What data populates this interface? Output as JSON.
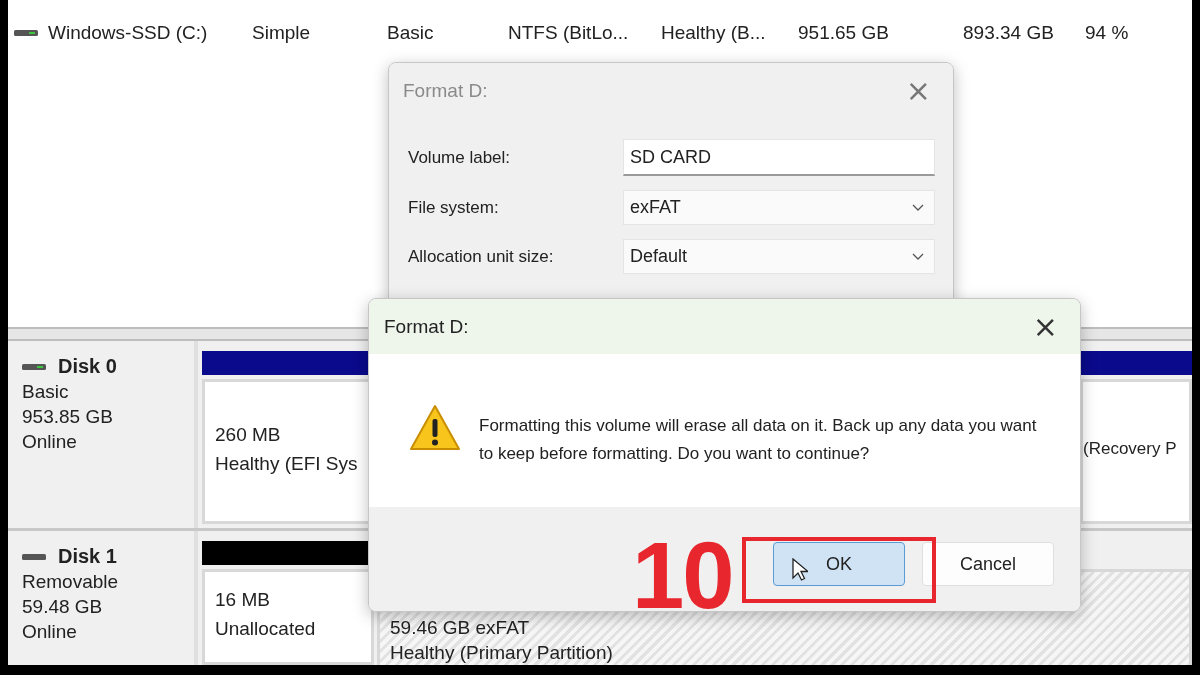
{
  "volumes": [
    {
      "name": "Windows-SSD (C:)",
      "layout": "Simple",
      "type": "Basic",
      "file_system": "NTFS (BitLo...",
      "status": "Healthy (B...",
      "capacity": "951.65 GB",
      "free_space": "893.34 GB",
      "percent_free": "94 %"
    }
  ],
  "disks": [
    {
      "name": "Disk 0",
      "type": "Basic",
      "size": "953.85 GB",
      "status": "Online",
      "kind": "fixed",
      "partitions": [
        {
          "kind": "primary",
          "selected": false,
          "size": "260 MB",
          "status": "Healthy (EFI Sys"
        },
        {
          "kind": "primary",
          "selected": false,
          "status": "(Recovery P"
        }
      ]
    },
    {
      "name": "Disk 1",
      "type": "Removable",
      "size": "59.48 GB",
      "status": "Online",
      "kind": "removable",
      "partitions": [
        {
          "kind": "unallocated",
          "selected": false,
          "size": "16 MB",
          "status": "Unallocated"
        },
        {
          "kind": "hidden",
          "selected": true,
          "size": "59.46 GB exFAT",
          "status": "Healthy (Primary Partition)"
        }
      ]
    }
  ],
  "format_dialog": {
    "title": "Format D:",
    "close": "×",
    "fields": [
      {
        "label": "Volume label:",
        "kind": "text",
        "value": "SD CARD"
      },
      {
        "label": "File system:",
        "kind": "dropdown",
        "value": "exFAT"
      },
      {
        "label": "Allocation unit size:",
        "kind": "dropdown",
        "value": "Default"
      }
    ]
  },
  "confirm_dialog": {
    "title": "Format D:",
    "close": "×",
    "message": "Formatting this volume will erase all data on it. Back up any data you want to keep before formatting. Do you want to continue?",
    "buttons": [
      {
        "label": "OK",
        "selected": true
      },
      {
        "label": "Cancel",
        "selected": false
      }
    ]
  },
  "step_annotation": "10"
}
